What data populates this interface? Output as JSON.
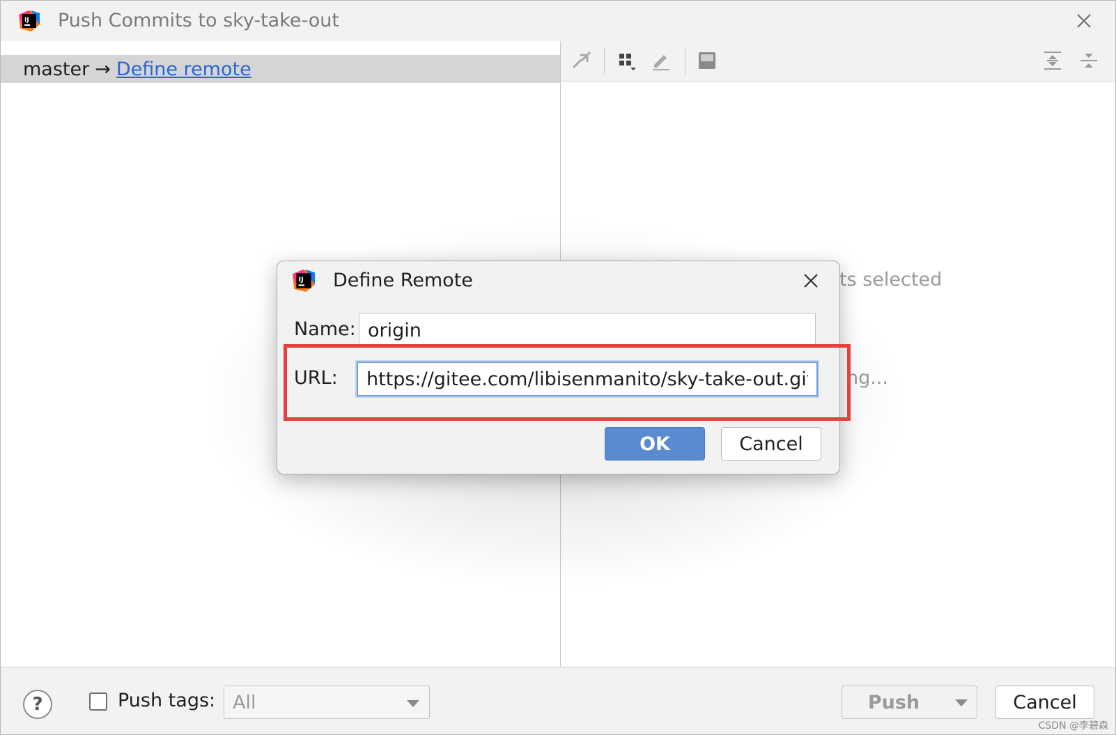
{
  "window": {
    "title": "Push Commits to sky-take-out",
    "close_icon": "close-icon",
    "app_icon": "intellij-idea-icon"
  },
  "repo_row": {
    "branch": "master",
    "arrow": "→",
    "define_remote_link": "Define remote"
  },
  "right_pane": {
    "toolbar_icons": [
      "cherry-pick-icon",
      "group-by-icon",
      "edit-icon",
      "preview-icon",
      "expand-all-icon",
      "collapse-all-icon"
    ],
    "msg_selected_fragment": "ts selected",
    "msg_loading_fragment": "ng..."
  },
  "define_remote_dialog": {
    "title": "Define Remote",
    "name_label": "Name:",
    "name_value": "origin",
    "url_label": "URL:",
    "url_value": "https://gitee.com/libisenmanito/sky-take-out.git",
    "ok_label": "OK",
    "cancel_label": "Cancel",
    "highlight_color": "#e3423b"
  },
  "footer": {
    "help_label": "?",
    "push_tags_label": "Push tags:",
    "push_tags_checked": false,
    "push_tags_select_value": "All",
    "push_label": "Push",
    "cancel_label": "Cancel"
  },
  "watermark": "CSDN @李碧森",
  "colors": {
    "accent_blue": "#5a8ad0",
    "link_blue": "#2f65ca",
    "focus_blue": "#6ea0de"
  }
}
